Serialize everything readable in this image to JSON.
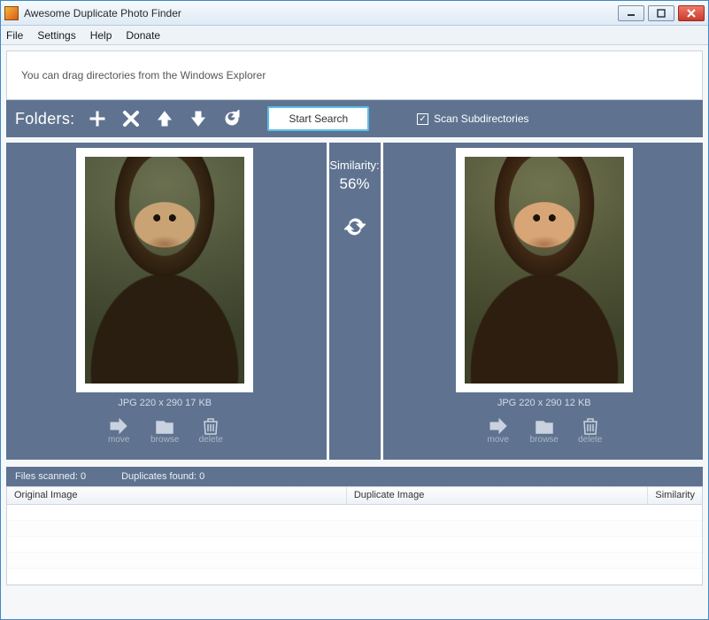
{
  "window": {
    "title": "Awesome Duplicate Photo Finder"
  },
  "menu": {
    "file": "File",
    "settings": "Settings",
    "help": "Help",
    "donate": "Donate"
  },
  "dropzone": {
    "hint": "You can drag directories from the Windows Explorer"
  },
  "toolbar": {
    "folders_label": "Folders:",
    "start_search": "Start Search",
    "scan_subdirs_label": "Scan Subdirectories",
    "scan_subdirs_checked": "✓"
  },
  "similarity": {
    "label": "Similarity:",
    "value": "56%"
  },
  "left": {
    "meta": "JPG  220 x 290  17 KB",
    "actions": {
      "move": "move",
      "browse": "browse",
      "delete": "delete"
    }
  },
  "right": {
    "meta": "JPG  220 x 290  12 KB",
    "actions": {
      "move": "move",
      "browse": "browse",
      "delete": "delete"
    }
  },
  "status": {
    "files_scanned": "Files scanned: 0",
    "duplicates_found": "Duplicates found: 0"
  },
  "results": {
    "columns": {
      "original": "Original Image",
      "duplicate": "Duplicate Image",
      "similarity": "Similarity"
    }
  }
}
